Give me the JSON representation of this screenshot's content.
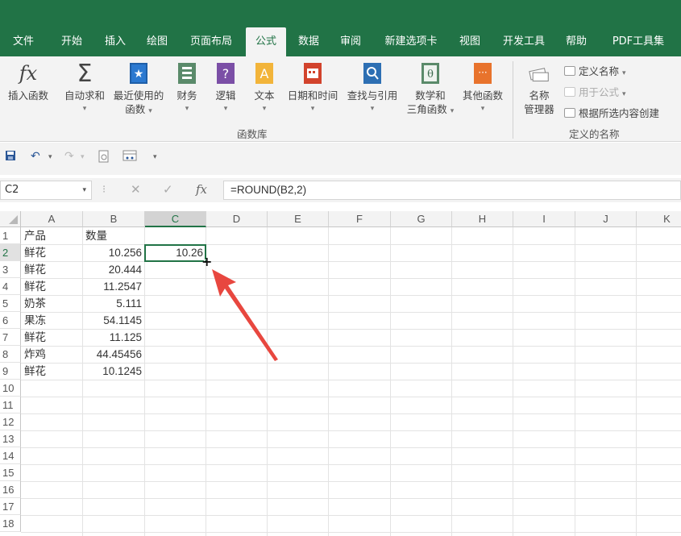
{
  "ribbon_tabs": [
    {
      "label": "文件"
    },
    {
      "label": "开始"
    },
    {
      "label": "插入"
    },
    {
      "label": "绘图"
    },
    {
      "label": "页面布局"
    },
    {
      "label": "公式",
      "active": true
    },
    {
      "label": "数据"
    },
    {
      "label": "审阅"
    },
    {
      "label": "新建选项卡"
    },
    {
      "label": "视图"
    },
    {
      "label": "开发工具"
    },
    {
      "label": "帮助"
    },
    {
      "label": "PDF工具集"
    }
  ],
  "ribbon": {
    "insert_function": "插入函数",
    "autosum": "自动求和",
    "recent_line1": "最近使用的",
    "recent_line2": "函数",
    "financial": "财务",
    "logical": "逻辑",
    "text": "文本",
    "datetime": "日期和时间",
    "lookup": "查找与引用",
    "math_line1": "数学和",
    "math_line2": "三角函数",
    "other": "其他函数",
    "group_library": "函数库",
    "name_manager_line1": "名称",
    "name_manager_line2": "管理器",
    "define_name": "定义名称",
    "use_in_formula": "用于公式",
    "create_from_selection": "根据所选内容创建",
    "group_defined_names": "定义的名称",
    "fx_glyph": "fx",
    "sigma_glyph": "Σ"
  },
  "formula_bar": {
    "name_box": "C2",
    "formula": "=ROUND(B2,2)",
    "fx_glyph": "fx"
  },
  "columns": [
    "A",
    "B",
    "C",
    "D",
    "E",
    "F",
    "G",
    "H",
    "I",
    "J",
    "K"
  ],
  "selected_column": "C",
  "rows": [
    "1",
    "2",
    "3",
    "4",
    "5",
    "6",
    "7",
    "8",
    "9",
    "10",
    "11",
    "12",
    "13",
    "14",
    "15",
    "16",
    "17",
    "18"
  ],
  "selected_row": "2",
  "cells": {
    "A1": "产品",
    "B1": "数量",
    "A2": "鲜花",
    "B2": "10.256",
    "C2": "10.26",
    "A3": "鲜花",
    "B3": "20.444",
    "A4": "鲜花",
    "B4": "11.2547",
    "A5": "奶茶",
    "B5": "5.111",
    "A6": "果冻",
    "B6": "54.1145",
    "A7": "鲜花",
    "B7": "11.125",
    "A8": "炸鸡",
    "B8": "44.45456",
    "A9": "鲜花",
    "B9": "10.1245"
  },
  "accent_color": "#217346",
  "annotation_arrow_color": "#e8473f"
}
